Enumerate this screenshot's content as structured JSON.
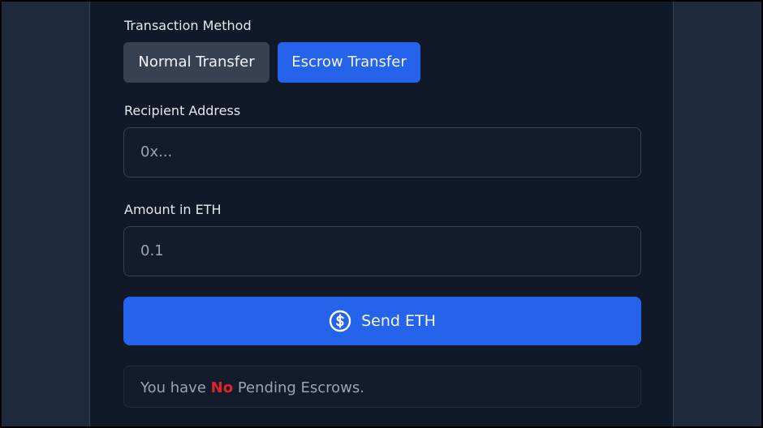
{
  "form": {
    "method_label": "Transaction Method",
    "normal_transfer": "Normal Transfer",
    "escrow_transfer": "Escrow Transfer",
    "recipient_label": "Recipient Address",
    "recipient_placeholder": "0x...",
    "amount_label": "Amount in ETH",
    "amount_placeholder": "0.1",
    "send_label": "Send ETH",
    "send_icon": "dollar-circle-icon"
  },
  "status": {
    "prefix": "You have",
    "emphasis": "No",
    "suffix": "Pending Escrows."
  },
  "colors": {
    "accent": "#2563eb",
    "secondary_button": "#374151",
    "status_emphasis": "#dc2626",
    "panel_background": "#111827",
    "page_background": "#1e293b"
  }
}
